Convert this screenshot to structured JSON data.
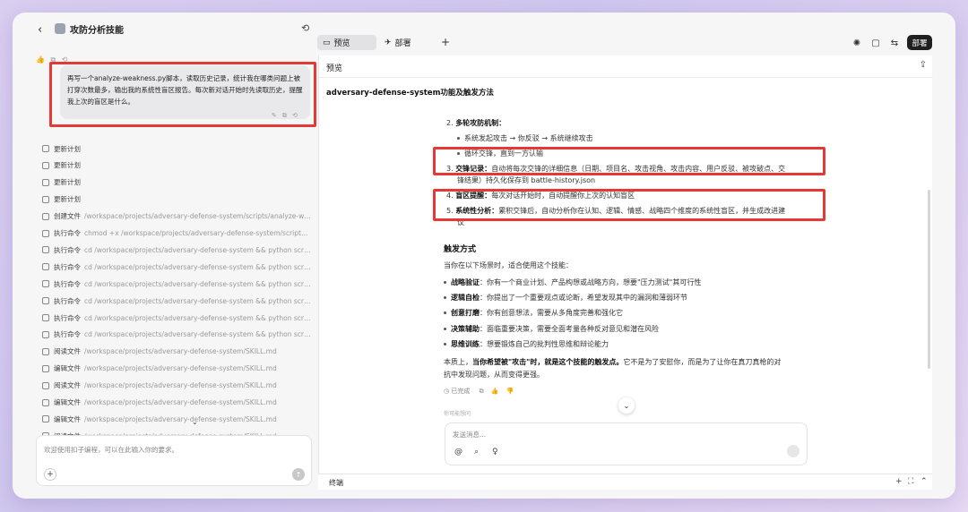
{
  "header": {
    "back_icon": "‹",
    "app_title": "攻防分析技能",
    "caret": "⌄",
    "history_icon": "⟲",
    "tabs": [
      {
        "label": "预览",
        "icon": "▭"
      },
      {
        "label": "部署",
        "icon": "✈"
      }
    ],
    "plus": "+",
    "right_icons": [
      "✺",
      "▢",
      "⇆"
    ],
    "deploy_label": "部署"
  },
  "left": {
    "mini_icons": "👍 ⧉ ⟲",
    "user_message": "再写一个analyze-weakness.py脚本，读取历史记录，统计我在哪类问题上被打穿次数最多，输出我的系统性盲区报告。每次新对话开始时先读取历史，提醒我上次的盲区是什么。",
    "bubble_icons": "✎ ⧉ ⟲",
    "steps": [
      {
        "name": "更新计划",
        "detail": ""
      },
      {
        "name": "更新计划",
        "detail": ""
      },
      {
        "name": "更新计划",
        "detail": ""
      },
      {
        "name": "更新计划",
        "detail": ""
      },
      {
        "name": "创建文件",
        "detail": "/workspace/projects/adversary-defense-system/scripts/analyze-weakne..."
      },
      {
        "name": "执行命令",
        "detail": "chmod +x /workspace/projects/adversary-defense-system/scripts/analyz..."
      },
      {
        "name": "执行命令",
        "detail": "cd /workspace/projects/adversary-defense-system && python scripts/an..."
      },
      {
        "name": "执行命令",
        "detail": "cd /workspace/projects/adversary-defense-system && python scripts/an..."
      },
      {
        "name": "执行命令",
        "detail": "cd /workspace/projects/adversary-defense-system && python scripts/an..."
      },
      {
        "name": "执行命令",
        "detail": "cd /workspace/projects/adversary-defense-system && python scripts/an..."
      },
      {
        "name": "执行命令",
        "detail": "cd /workspace/projects/adversary-defense-system && python scripts/an..."
      },
      {
        "name": "执行命令",
        "detail": "cd /workspace/projects/adversary-defense-system && python scripts/an..."
      },
      {
        "name": "阅读文件",
        "detail": "/workspace/projects/adversary-defense-system/SKILL.md"
      },
      {
        "name": "编辑文件",
        "detail": "/workspace/projects/adversary-defense-system/SKILL.md"
      },
      {
        "name": "阅读文件",
        "detail": "/workspace/projects/adversary-defense-system/SKILL.md"
      },
      {
        "name": "编辑文件",
        "detail": "/workspace/projects/adversary-defense-system/SKILL.md"
      },
      {
        "name": "编辑文件",
        "detail": "/workspace/projects/adversary-defense-system/SKILL.md"
      },
      {
        "name": "阅读文件",
        "detail": "/workspace/projects/adversary-defense-system/SKILL.md"
      }
    ],
    "expand_caret": "⌄",
    "input_placeholder": "欢迎使用扣子编程，可以在此输入你的要求。",
    "plus": "+",
    "send": "↑"
  },
  "preview": {
    "label": "预览",
    "share_icon": "⇪",
    "doc_title": "adversary-defense-system功能及触发方法",
    "item2_num": "2.",
    "item2_title": "多轮攻防机制：",
    "sub1": "系统发起攻击 → 你反驳 → 系统继续攻击",
    "sub2": "循环交锋，直到一方认输",
    "item3_num": "3.",
    "item3_title": "交锋记录：",
    "item3_text_line1": "自动将每次交锋的详细信息（日期、项目名、攻击视角、攻击内容、用户反驳、被攻破点、交",
    "item3_text_line2": "锋结果）持久化保存到 battle-history.json",
    "item4_num": "4.",
    "item4_title": "盲区提醒：",
    "item4_text": "每次对话开始时，自动提醒你上次的认知盲区",
    "item5_num": "5.",
    "item5_title": "系统性分析：",
    "item5_text_line1": "累积交锋后，自动分析你在认知、逻辑、情感、战略四个维度的系统性盲区，并生成改进建",
    "item5_text_line2": "议",
    "trigger_heading": "触发方式",
    "trigger_intro": "当你在以下场景时，适合使用这个技能：",
    "triggers": [
      {
        "title": "战略验证",
        "text": "：你有一个商业计划、产品构想或战略方向，想要\"压力测试\"其可行性"
      },
      {
        "title": "逻辑自检",
        "text": "：你提出了一个重要观点或论断，希望发现其中的漏洞和薄弱环节"
      },
      {
        "title": "创意打磨",
        "text": "：你有创意想法，需要从多角度完善和强化它"
      },
      {
        "title": "决策辅助",
        "text": "：面临重要决策，需要全面考量各种反对意见和潜在风险"
      },
      {
        "title": "思维训练",
        "text": "：想要锻炼自己的批判性思维和辩论能力"
      }
    ],
    "summary_prefix": "本质上，",
    "summary_bold": "当你希望被\"攻击\"时，就是这个技能的触发点。",
    "summary_rest": "它不是为了安慰你，而是为了让你在真刀真枪的对",
    "summary_line2": "抗中发现问题，从而变得更强。",
    "done_label": "已完成",
    "footer_icons": "⧉ 👍 👎",
    "maybe_ask": "你可能想问",
    "down_icon": "⌄",
    "chat_placeholder": "发送消息...",
    "chat_icons": [
      "@",
      "⌕",
      "♀"
    ]
  },
  "terminal": {
    "label": "终端",
    "icons": [
      "+",
      "⛶",
      "⌃"
    ]
  }
}
